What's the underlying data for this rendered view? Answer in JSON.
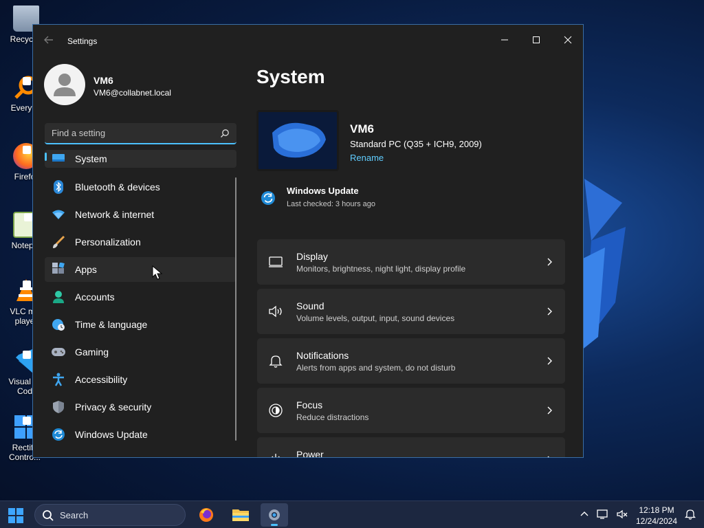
{
  "desktop": {
    "icons": [
      {
        "label": "Recycle",
        "icon": "recycle-bin-icon"
      },
      {
        "label": "Everyth",
        "icon": "everything-search-icon"
      },
      {
        "label": "Firefo",
        "icon": "firefox-icon"
      },
      {
        "label": "Notepa",
        "icon": "notepad-icon"
      },
      {
        "label": "VLC me playe",
        "icon": "vlc-icon"
      },
      {
        "label": "Visual St Cod",
        "icon": "vscode-icon"
      },
      {
        "label": "Rectify Contro...",
        "icon": "control-panel-icon"
      }
    ]
  },
  "window": {
    "title": "Settings",
    "controls": {
      "minimize": "minimize-icon",
      "maximize": "maximize-icon",
      "close": "close-icon"
    }
  },
  "profile": {
    "name": "VM6",
    "email": "VM6@collabnet.local"
  },
  "search": {
    "placeholder": "Find a setting"
  },
  "nav": {
    "items": [
      {
        "label": "System",
        "icon": "system-icon",
        "selected": true
      },
      {
        "label": "Bluetooth & devices",
        "icon": "bluetooth-icon"
      },
      {
        "label": "Network & internet",
        "icon": "wifi-icon"
      },
      {
        "label": "Personalization",
        "icon": "brush-icon"
      },
      {
        "label": "Apps",
        "icon": "apps-icon"
      },
      {
        "label": "Accounts",
        "icon": "accounts-icon"
      },
      {
        "label": "Time & language",
        "icon": "globe-clock-icon"
      },
      {
        "label": "Gaming",
        "icon": "gamepad-icon"
      },
      {
        "label": "Accessibility",
        "icon": "accessibility-icon"
      },
      {
        "label": "Privacy & security",
        "icon": "shield-icon"
      },
      {
        "label": "Windows Update",
        "icon": "update-icon"
      }
    ]
  },
  "main": {
    "title": "System",
    "device": {
      "name": "VM6",
      "model": "Standard PC (Q35 + ICH9, 2009)",
      "rename": "Rename"
    },
    "update": {
      "title": "Windows Update",
      "subtitle": "Last checked: 3 hours ago"
    },
    "cards": [
      {
        "title": "Display",
        "subtitle": "Monitors, brightness, night light, display profile",
        "icon": "display-icon"
      },
      {
        "title": "Sound",
        "subtitle": "Volume levels, output, input, sound devices",
        "icon": "speaker-icon"
      },
      {
        "title": "Notifications",
        "subtitle": "Alerts from apps and system, do not disturb",
        "icon": "bell-icon"
      },
      {
        "title": "Focus",
        "subtitle": "Reduce distractions",
        "icon": "focus-icon"
      },
      {
        "title": "Power",
        "subtitle": "",
        "icon": "power-icon"
      }
    ]
  },
  "taskbar": {
    "search_label": "Search",
    "time": "12:18 PM",
    "date": "12/24/2024"
  },
  "colors": {
    "accent": "#4cc2ff",
    "link": "#60cdff",
    "window_bg": "#202020",
    "card_bg": "#2b2b2b"
  }
}
